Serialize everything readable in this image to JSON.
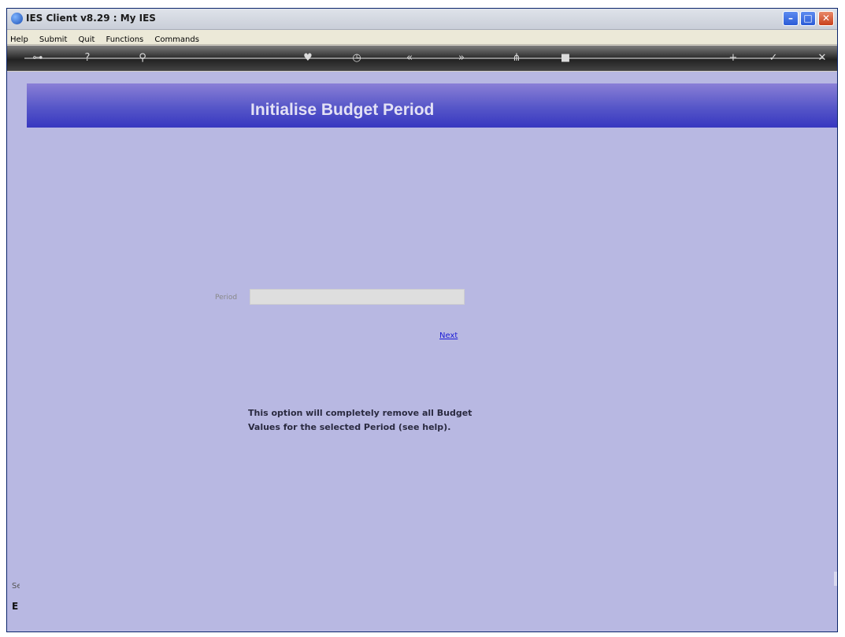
{
  "window": {
    "title": "IES Client v8.29 : My IES"
  },
  "menu": {
    "items": [
      "Help",
      "Submit",
      "Quit",
      "Functions",
      "Commands"
    ]
  },
  "toolbar": {
    "icons": [
      {
        "name": "key-icon",
        "glyph": "⊶"
      },
      {
        "name": "help-icon",
        "glyph": "?"
      },
      {
        "name": "search-icon",
        "glyph": "⚲"
      },
      {
        "name": "heart-icon",
        "glyph": "♥"
      },
      {
        "name": "clock-icon",
        "glyph": "◷"
      },
      {
        "name": "previous-icon",
        "glyph": "«"
      },
      {
        "name": "next-icon",
        "glyph": "»"
      },
      {
        "name": "tree-icon",
        "glyph": "⋔"
      },
      {
        "name": "stop-icon",
        "glyph": "■"
      },
      {
        "name": "plus-icon",
        "glyph": "+"
      },
      {
        "name": "check-icon",
        "glyph": "✓"
      },
      {
        "name": "close-icon",
        "glyph": "✕"
      }
    ]
  },
  "header": {
    "title": "Initialise Budget Period"
  },
  "form": {
    "period_label": "Period",
    "period_value": "",
    "next_link": "Next"
  },
  "message": {
    "line1": "This option will completely remove all Budget",
    "line2": "Values for the selected Period (see help)."
  },
  "sidebar": {
    "fragment1": "Se",
    "fragment2": "E"
  },
  "colors": {
    "background": "#b8b8e2",
    "banner_top": "#8a7fd6",
    "banner_bottom": "#3737c0",
    "link": "#1b1bd6"
  }
}
